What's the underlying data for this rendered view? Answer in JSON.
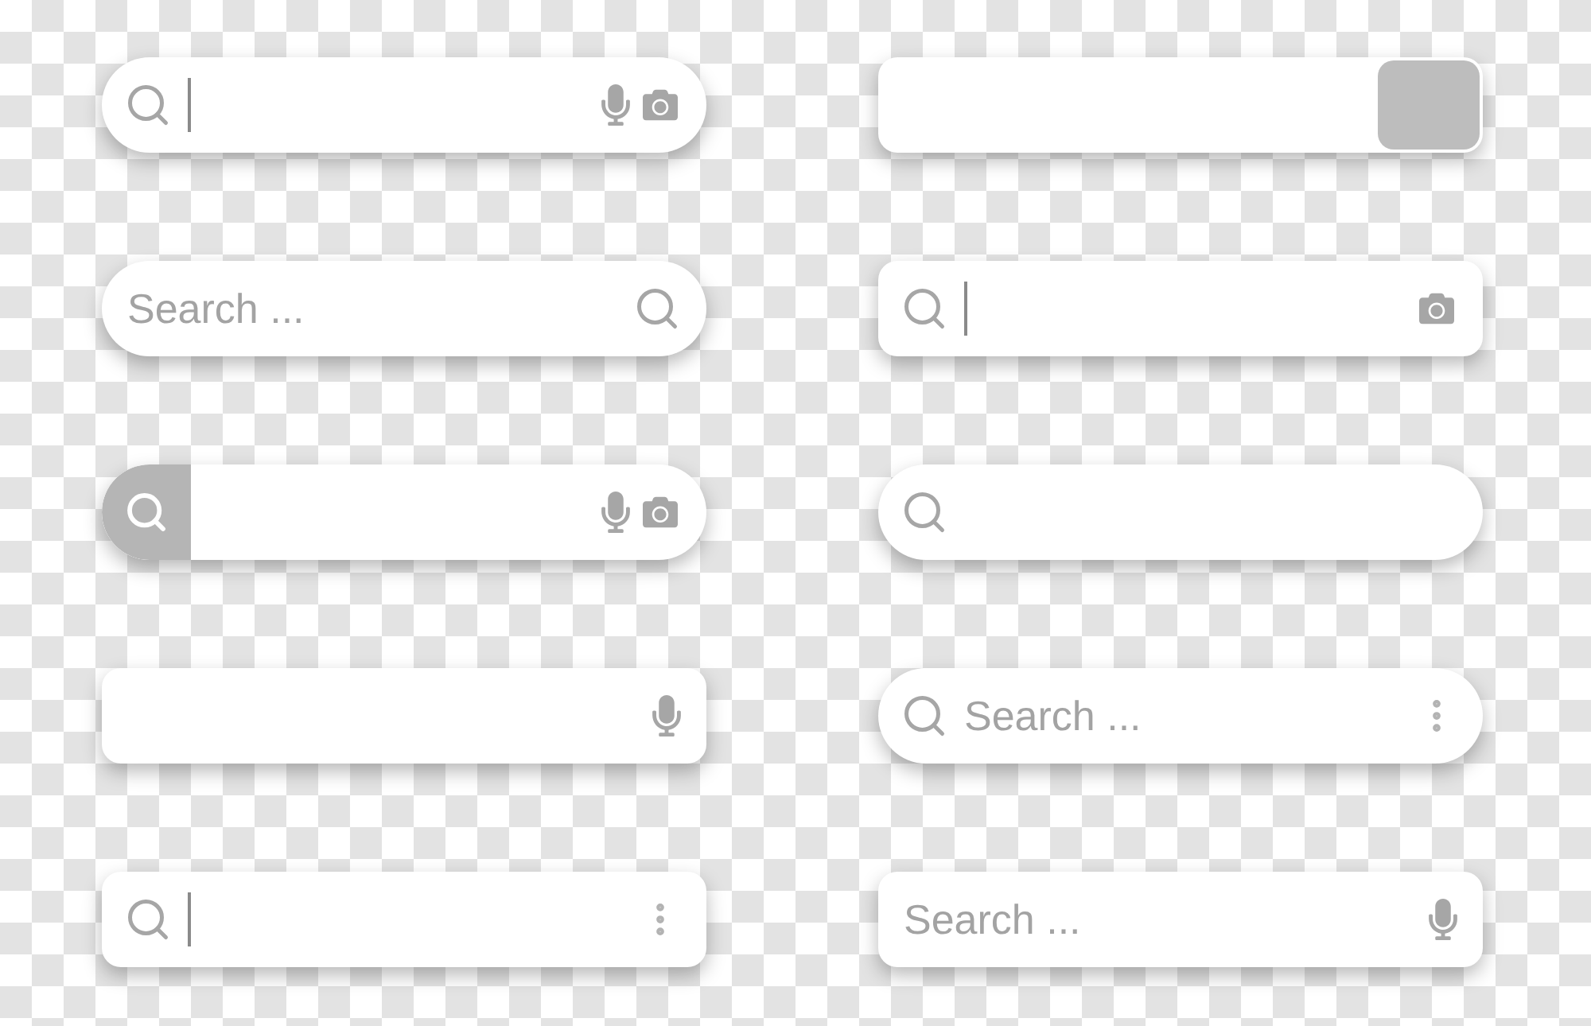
{
  "columns": [
    {
      "bars": [
        {
          "kind": "pill",
          "start": [
            {
              "kind": "search"
            },
            {
              "kind": "cursor"
            }
          ],
          "end": [
            {
              "kind": "mic"
            },
            {
              "kind": "camera"
            }
          ]
        },
        {
          "kind": "pill",
          "start": [
            {
              "kind": "placeholder",
              "text": "Search ..."
            }
          ],
          "end": [
            {
              "kind": "search"
            }
          ]
        },
        {
          "kind": "pill",
          "start": [
            {
              "kind": "search_button"
            }
          ],
          "end": [
            {
              "kind": "mic"
            },
            {
              "kind": "camera"
            }
          ]
        },
        {
          "kind": "rounded",
          "end": [
            {
              "kind": "mic"
            }
          ]
        },
        {
          "kind": "rounded",
          "start": [
            {
              "kind": "search"
            },
            {
              "kind": "cursor"
            }
          ],
          "end": [
            {
              "kind": "more"
            }
          ]
        }
      ]
    },
    {
      "bars": [
        {
          "kind": "rounded",
          "end": [
            {
              "kind": "submit_button"
            }
          ]
        },
        {
          "kind": "rounded",
          "start": [
            {
              "kind": "search"
            },
            {
              "kind": "cursor"
            }
          ],
          "end": [
            {
              "kind": "camera"
            }
          ]
        },
        {
          "kind": "pill",
          "start": [
            {
              "kind": "search"
            }
          ]
        },
        {
          "kind": "pill",
          "start": [
            {
              "kind": "search"
            },
            {
              "kind": "placeholder",
              "text": "Search ..."
            }
          ],
          "end": [
            {
              "kind": "more"
            }
          ]
        },
        {
          "kind": "rounded",
          "start": [
            {
              "kind": "placeholder",
              "text": "Search ..."
            }
          ],
          "end": [
            {
              "kind": "mic"
            }
          ]
        }
      ]
    }
  ]
}
